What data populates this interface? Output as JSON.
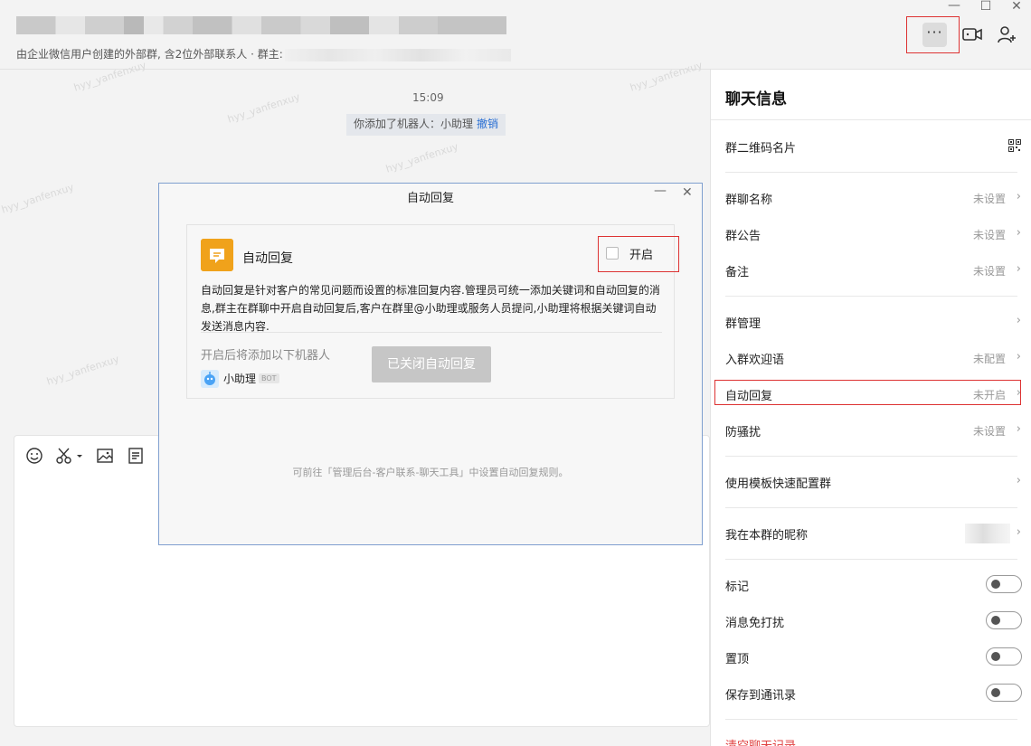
{
  "window": {
    "minimize_glyph": "—",
    "maximize_glyph": "☐",
    "close_glyph": "✕"
  },
  "header": {
    "subtitle": "由企业微信用户创建的外部群, 含2位外部联系人 · 群主:",
    "more_glyph": "···",
    "icons": [
      "more-icon",
      "video-call-icon",
      "add-member-icon"
    ]
  },
  "chat": {
    "time": "15:09",
    "system_message": "你添加了机器人：小助理",
    "system_link": "撤销",
    "watermark": "hyy_yanfenxuy"
  },
  "editor": {
    "tools": [
      "emoji-icon",
      "scissors-icon",
      "image-icon",
      "document-icon"
    ]
  },
  "modal": {
    "title": "自动回复",
    "card_title": "自动回复",
    "enable_label": "开启",
    "description": "自动回复是针对客户的常见问题而设置的标准回复内容.管理员可统一添加关键词和自动回复的消息,群主在群聊中开启自动回复后,客户在群里@小助理或服务人员提问,小助理将根据关键词自动发送消息内容.",
    "bot_hint": "开启后将添加以下机器人",
    "bot_name": "小助理",
    "bot_tag": "BOT",
    "closed_button": "已关闭自动回复",
    "footer": "可前往「管理后台-客户联系-聊天工具」中设置自动回复规则。",
    "accent": "#f0a21b"
  },
  "panel": {
    "title": "聊天信息",
    "qr_label": "群二维码名片",
    "rows": [
      {
        "label": "群聊名称",
        "value": "未设置"
      },
      {
        "label": "群公告",
        "value": "未设置"
      },
      {
        "label": "备注",
        "value": "未设置"
      },
      {
        "label": "群管理",
        "value": ""
      },
      {
        "label": "入群欢迎语",
        "value": "未配置"
      },
      {
        "label": "自动回复",
        "value": "未开启"
      },
      {
        "label": "防骚扰",
        "value": "未设置"
      },
      {
        "label": "使用模板快速配置群",
        "value": ""
      },
      {
        "label": "我在本群的昵称",
        "value": ""
      }
    ],
    "toggles": [
      {
        "label": "标记",
        "on": false
      },
      {
        "label": "消息免打扰",
        "on": false
      },
      {
        "label": "置顶",
        "on": false
      },
      {
        "label": "保存到通讯录",
        "on": false
      }
    ],
    "danger_label": "清空聊天记录",
    "chevron": "›"
  }
}
